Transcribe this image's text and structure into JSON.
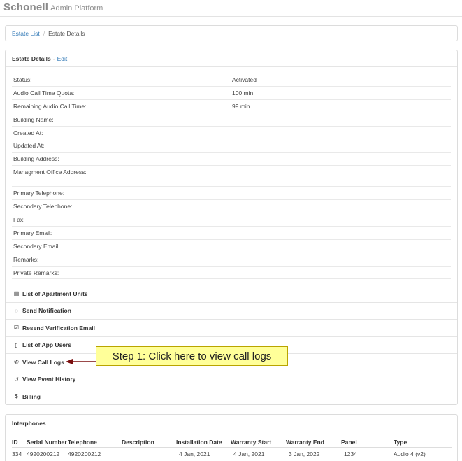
{
  "brand": {
    "logo": "Schonell",
    "subtitle": "Admin Platform"
  },
  "breadcrumb": {
    "items": [
      "Estate List",
      "Estate Details"
    ]
  },
  "details": {
    "title": "Estate Details",
    "edit_label": "Edit",
    "rows": [
      {
        "label": "Status:",
        "value": "Activated"
      },
      {
        "label": "Audio Call Time Quota:",
        "value": "100 min"
      },
      {
        "label": "Remaining Audio Call Time:",
        "value": "99 min"
      },
      {
        "label": "Building Name:",
        "value": ""
      },
      {
        "label": "Created At:",
        "value": ""
      },
      {
        "label": "Updated At:",
        "value": ""
      },
      {
        "label": "Building Address:",
        "value": ""
      },
      {
        "label": "Managment Office Address:",
        "value": ""
      },
      {
        "label": "Primary Telephone:",
        "value": ""
      },
      {
        "label": "Secondary Telephone:",
        "value": ""
      },
      {
        "label": "Fax:",
        "value": ""
      },
      {
        "label": "Primary Email:",
        "value": ""
      },
      {
        "label": "Secondary Email:",
        "value": ""
      },
      {
        "label": "Remarks:",
        "value": ""
      },
      {
        "label": "Private Remarks:",
        "value": ""
      }
    ]
  },
  "actions": [
    {
      "icon": "id-card-icon",
      "glyph": "▤",
      "label": "List of Apartment Units"
    },
    {
      "icon": "speech-bubble-icon",
      "glyph": "◌",
      "label": "Send Notification"
    },
    {
      "icon": "check-square-icon",
      "glyph": "☑",
      "label": "Resend Verification Email"
    },
    {
      "icon": "mobile-phone-icon",
      "glyph": "▯",
      "label": "List of App Users"
    },
    {
      "icon": "phone-icon",
      "glyph": "✆",
      "label": "View Call Logs"
    },
    {
      "icon": "history-icon",
      "glyph": "↺",
      "label": "View Event History"
    },
    {
      "icon": "dollar-icon",
      "glyph": "$",
      "label": "Billing"
    }
  ],
  "interphones": {
    "title": "Interphones",
    "columns": [
      "ID",
      "Serial Number",
      "Telephone",
      "Description",
      "Installation Date",
      "Warranty Start",
      "Warranty End",
      "Panel",
      "Type"
    ],
    "rows": [
      [
        "334",
        "4920200212",
        "4920200212",
        "",
        "4 Jan, 2021",
        "4 Jan, 2021",
        "3 Jan, 2022",
        "1234",
        "Audio 4 (v2)"
      ]
    ]
  },
  "callout": {
    "text": "Step 1: Click here to view call logs"
  },
  "colors": {
    "link": "#337ab7",
    "callout_bg": "#ffff99",
    "arrow": "#7a0e0e"
  }
}
